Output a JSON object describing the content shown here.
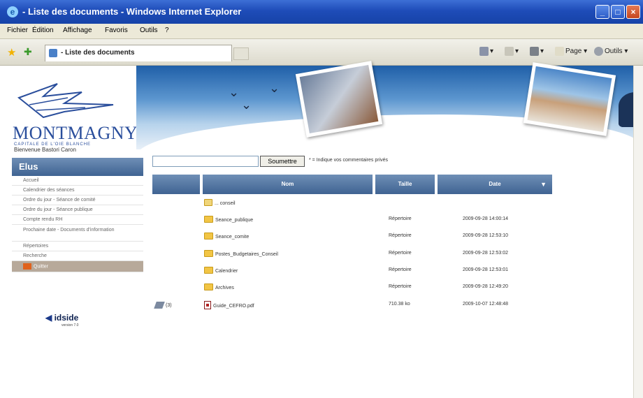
{
  "window": {
    "title": "- Liste des documents - Windows Internet Explorer"
  },
  "menu": [
    "Fichier",
    "Édition",
    "Affichage",
    "Favoris",
    "Outils",
    "?"
  ],
  "tab": {
    "label": "- Liste des documents"
  },
  "toolbar": {
    "page_label": "Page",
    "tools_label": "Outils"
  },
  "site": {
    "logo_name": "MONTMAGNY",
    "logo_sub": "CAPITALE DE L'OIE BLANCHE",
    "welcome": "Bienvenue Bastori Caron"
  },
  "sidebar": {
    "heading": "Elus",
    "items": [
      "Accueil",
      "Calendrier des séances",
      "Ordre du jour - Séance de comité",
      "Ordre du jour - Séance publique",
      "Compte rendu RH",
      "Prochaine date - Documents d'information",
      "Répertoires",
      "Recherche"
    ],
    "selected": "Quitter",
    "brand": "idside",
    "version": "version 7.0"
  },
  "search": {
    "placeholder": "",
    "button": "Soumettre",
    "hint": "* = Indique vos commentaires privés"
  },
  "table": {
    "headers": [
      "Nom",
      "Taille",
      "Date"
    ],
    "rows": [
      {
        "icon": "parent-folder-icon",
        "name": "... conseil",
        "size": "",
        "date": "",
        "note": ""
      },
      {
        "icon": "folder-icon",
        "name": "Seance_publique",
        "size": "Répertoire",
        "date": "2009-09-28 14:00:14",
        "note": ""
      },
      {
        "icon": "folder-icon",
        "name": "Seance_comite",
        "size": "Répertoire",
        "date": "2009-09-28 12:53:10",
        "note": ""
      },
      {
        "icon": "folder-icon",
        "name": "Postes_Budgetaires_Conseil",
        "size": "Répertoire",
        "date": "2009-09-28 12:53:02",
        "note": ""
      },
      {
        "icon": "folder-icon",
        "name": "Calendrier",
        "size": "Répertoire",
        "date": "2009-09-28 12:53:01",
        "note": ""
      },
      {
        "icon": "folder-icon",
        "name": "Archives",
        "size": "Répertoire",
        "date": "2009-09-28 12:49:20",
        "note": ""
      },
      {
        "icon": "pdf-icon",
        "name": "Guide_CEFRO.pdf",
        "size": "710.38 ko",
        "date": "2009-10-07 12:48:48",
        "note": "(3)"
      }
    ]
  },
  "colors": {
    "header_blue": "#3f6392",
    "titlebar": "#1e4cb8",
    "folder": "#f2c545"
  }
}
